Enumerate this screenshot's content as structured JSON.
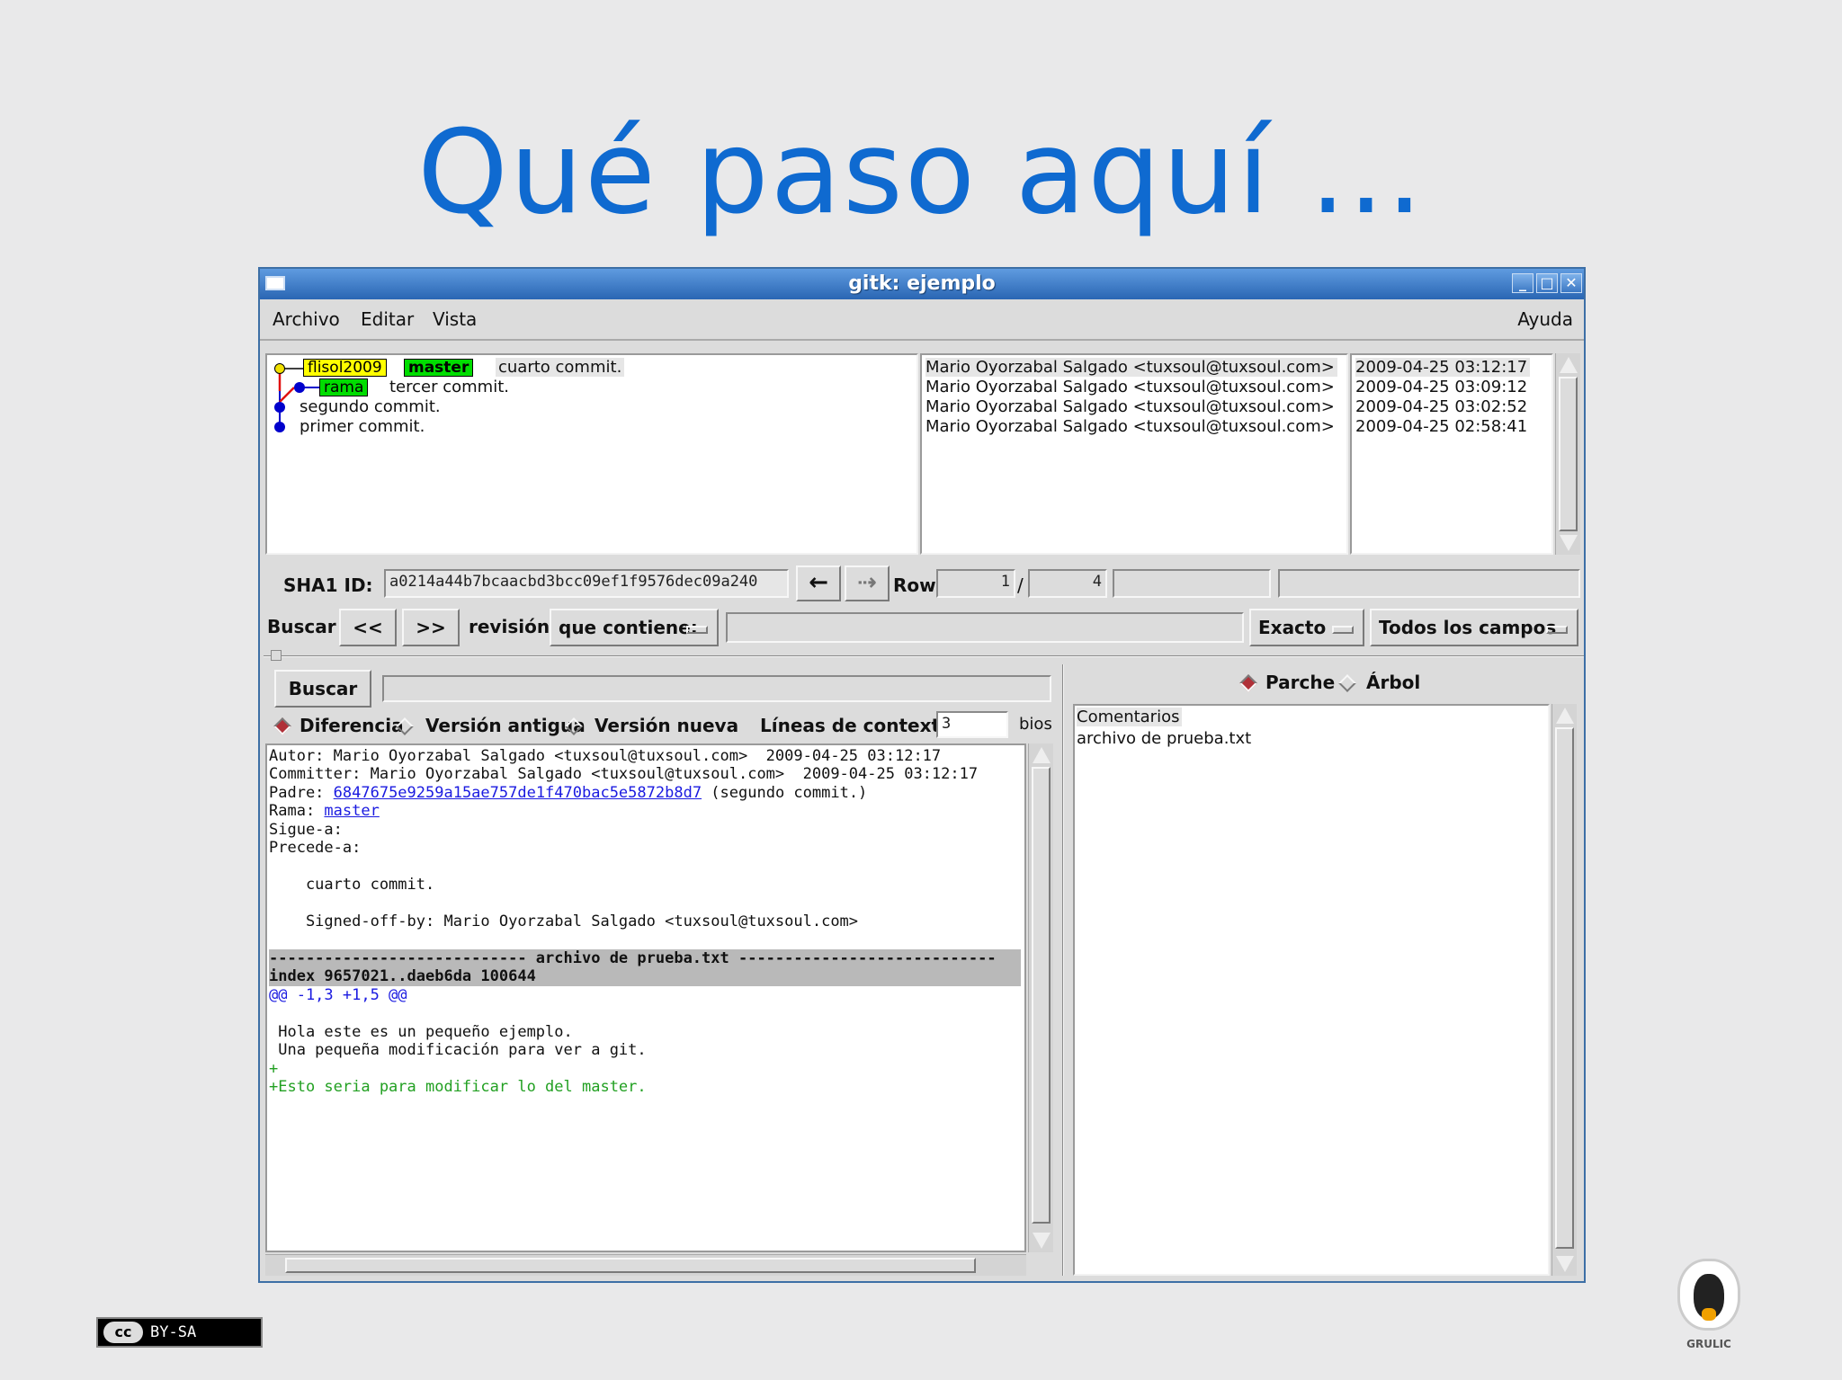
{
  "slide": {
    "title": "Qué paso aquí ..."
  },
  "window": {
    "title": "gitk: ejemplo",
    "controls": {
      "minimize": "_",
      "maximize": "□",
      "close": "✕"
    }
  },
  "menu": {
    "file": "Archivo",
    "edit": "Editar",
    "view": "Vista",
    "help": "Ayuda"
  },
  "commits": [
    {
      "message": "cuarto commit.",
      "author": "Mario Oyorzabal Salgado <tuxsoul@tuxsoul.com>",
      "date": "2009-04-25 03:12:17",
      "tags": [
        "flisol2009",
        "master"
      ]
    },
    {
      "message": "tercer commit.",
      "author": "Mario Oyorzabal Salgado <tuxsoul@tuxsoul.com>",
      "date": "2009-04-25 03:09:12",
      "tags": [
        "rama"
      ]
    },
    {
      "message": "segundo commit.",
      "author": "Mario Oyorzabal Salgado <tuxsoul@tuxsoul.com>",
      "date": "2009-04-25 03:02:52",
      "tags": []
    },
    {
      "message": "primer commit.",
      "author": "Mario Oyorzabal Salgado <tuxsoul@tuxsoul.com>",
      "date": "2009-04-25 02:58:41",
      "tags": []
    }
  ],
  "sha": {
    "label": "SHA1 ID:",
    "value": "a0214a44b7bcaacbd3bcc09ef1f9576dec09a240",
    "row_label": "Row",
    "row_current": "1",
    "row_sep": "/",
    "row_total": "4"
  },
  "find": {
    "label": "Buscar",
    "prev": "<<",
    "next": ">>",
    "type": "revisión",
    "mode": "que contiene:",
    "match": "Exacto",
    "fields": "Todos los campos"
  },
  "search": {
    "button": "Buscar"
  },
  "diff_options": {
    "diff": "Diferencia",
    "old": "Versión antigua",
    "new": "Versión nueva",
    "context_label": "Líneas de contexto:",
    "context_value": "3",
    "trailing": "bios"
  },
  "details": {
    "author": "Autor: Mario Oyorzabal Salgado <tuxsoul@tuxsoul.com>  2009-04-25 03:12:17",
    "committer": "Committer: Mario Oyorzabal Salgado <tuxsoul@tuxsoul.com>  2009-04-25 03:12:17",
    "parent_label": "Padre: ",
    "parent_hash": "6847675e9259a15ae757de1f470bac5e5872b8d7",
    "parent_msg": " (segundo commit.)",
    "branch_label": "Rama: ",
    "branch": "master",
    "follows": "Sigue-a:",
    "precedes": "Precede-a:",
    "message": "    cuarto commit.",
    "signoff": "    Signed-off-by: Mario Oyorzabal Salgado <tuxsoul@tuxsoul.com>",
    "file_header": "---------------------------- archivo de prueba.txt ----------------------------",
    "index": "index 9657021..daeb6da 100644",
    "hunk": "@@ -1,3 +1,5 @@",
    "ctx1": " Hola este es un pequeño ejemplo.",
    "ctx2": " Una pequeña modificación para ver a git.",
    "add1": "+",
    "add2": "+Esto seria para modificar lo del master."
  },
  "right_panel": {
    "patch": "Parche",
    "tree": "Árbol",
    "items": [
      "Comentarios",
      "archivo de prueba.txt"
    ]
  },
  "footer": {
    "license": "BY-SA",
    "cc": "cc",
    "logo_text": "GRULIC"
  }
}
